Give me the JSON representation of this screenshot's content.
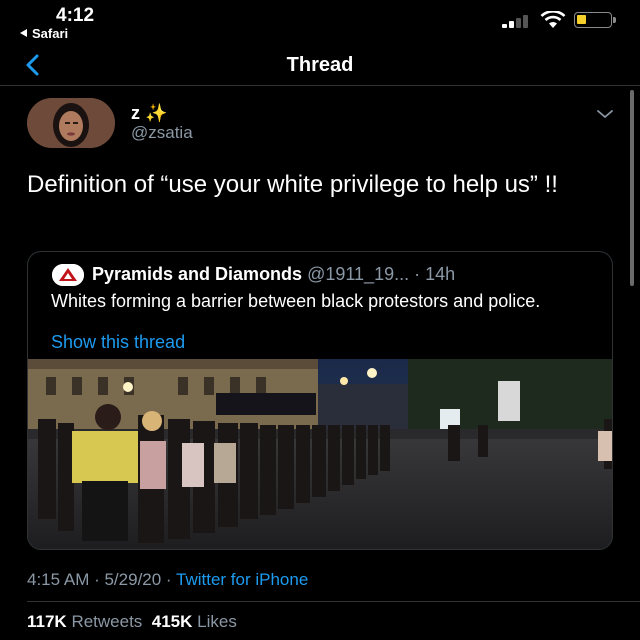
{
  "status_bar": {
    "time": "4:12",
    "back_app": "Safari",
    "battery_color": "#f5d02b"
  },
  "nav": {
    "title": "Thread",
    "back_icon": "chevron-left-icon"
  },
  "tweet": {
    "display_name": "z ✨",
    "username": "@zsatia",
    "text": "Definition of “use your white privilege to help us” !!",
    "timestamp": "4:15 AM · 5/29/20 · ",
    "source": "Twitter for iPhone",
    "retweets_count": "117K",
    "retweets_label": "Retweets",
    "likes_count": "415K",
    "likes_label": "Likes"
  },
  "quoted_tweet": {
    "display_name": "Pyramids and Diamonds",
    "meta": "@1911_19... · 14h",
    "text": "Whites forming a barrier between black protestors and police.",
    "link_label": "Show this thread"
  },
  "colors": {
    "background": "#000000",
    "link": "#1d9bf0",
    "secondary_text": "#8b98a5",
    "divider": "#2f3336"
  }
}
